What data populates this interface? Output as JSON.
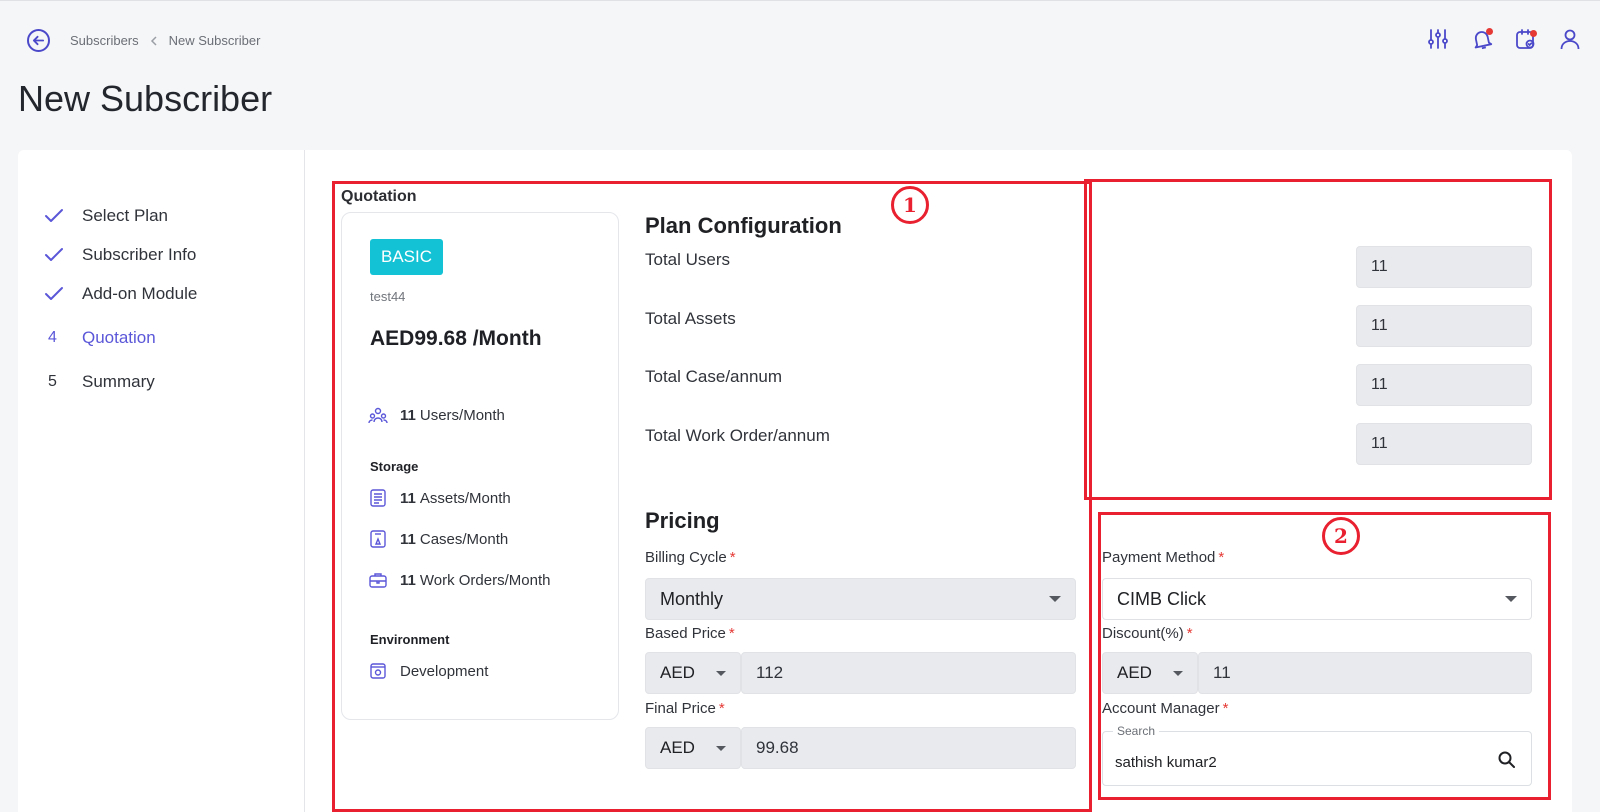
{
  "breadcrumb": {
    "parent": "Subscribers",
    "current": "New Subscriber"
  },
  "page_title": "New Subscriber",
  "steps": [
    {
      "label": "Select Plan",
      "status": "done"
    },
    {
      "label": "Subscriber Info",
      "status": "done"
    },
    {
      "label": "Add-on Module",
      "status": "done"
    },
    {
      "number": "4",
      "label": "Quotation",
      "status": "active"
    },
    {
      "number": "5",
      "label": "Summary",
      "status": "pending"
    }
  ],
  "quotation": {
    "title": "Quotation",
    "plan": {
      "tier": "BASIC",
      "name": "test44",
      "price": "AED99.68 /Month",
      "users": {
        "count": "11",
        "label": "Users/Month"
      },
      "storage_title": "Storage",
      "assets": {
        "count": "11",
        "label": "Assets/Month"
      },
      "cases": {
        "count": "11",
        "label": "Cases/Month"
      },
      "work_orders": {
        "count": "11",
        "label": "Work Orders/Month"
      },
      "environment_title": "Environment",
      "environment": "Development"
    }
  },
  "plan_configuration": {
    "title": "Plan Configuration",
    "total_users": {
      "label": "Total Users",
      "value": "11"
    },
    "total_assets": {
      "label": "Total Assets",
      "value": "11"
    },
    "total_cases": {
      "label": "Total Case/annum",
      "value": "11"
    },
    "total_work_orders": {
      "label": "Total Work Order/annum",
      "value": "11"
    }
  },
  "pricing": {
    "title": "Pricing",
    "billing_cycle": {
      "label": "Billing Cycle",
      "value": "Monthly"
    },
    "based_price": {
      "label": "Based Price",
      "currency": "AED",
      "value": "112"
    },
    "final_price": {
      "label": "Final Price",
      "currency": "AED",
      "value": "99.68"
    },
    "payment_method": {
      "label": "Payment Method",
      "value": "CIMB Click"
    },
    "discount": {
      "label": "Discount(%)",
      "currency": "AED",
      "value": "11"
    },
    "account_manager": {
      "label": "Account Manager",
      "search_legend": "Search",
      "value": "sathish kumar2"
    },
    "required_mark": "*"
  },
  "annotations": {
    "badge_1": "1",
    "badge_2": "2"
  },
  "colors": {
    "accent": "#5b57d9",
    "badge": "#13c2d4",
    "annotation": "#e8202f",
    "required": "#e53935"
  },
  "icons": [
    "arrow-left-icon",
    "chevron-left-icon",
    "sliders-icon",
    "bell-icon",
    "calendar-check-icon",
    "user-icon",
    "check-icon",
    "users-icon",
    "document-list-icon",
    "case-icon",
    "toolbox-icon",
    "environment-icon",
    "search-icon"
  ]
}
